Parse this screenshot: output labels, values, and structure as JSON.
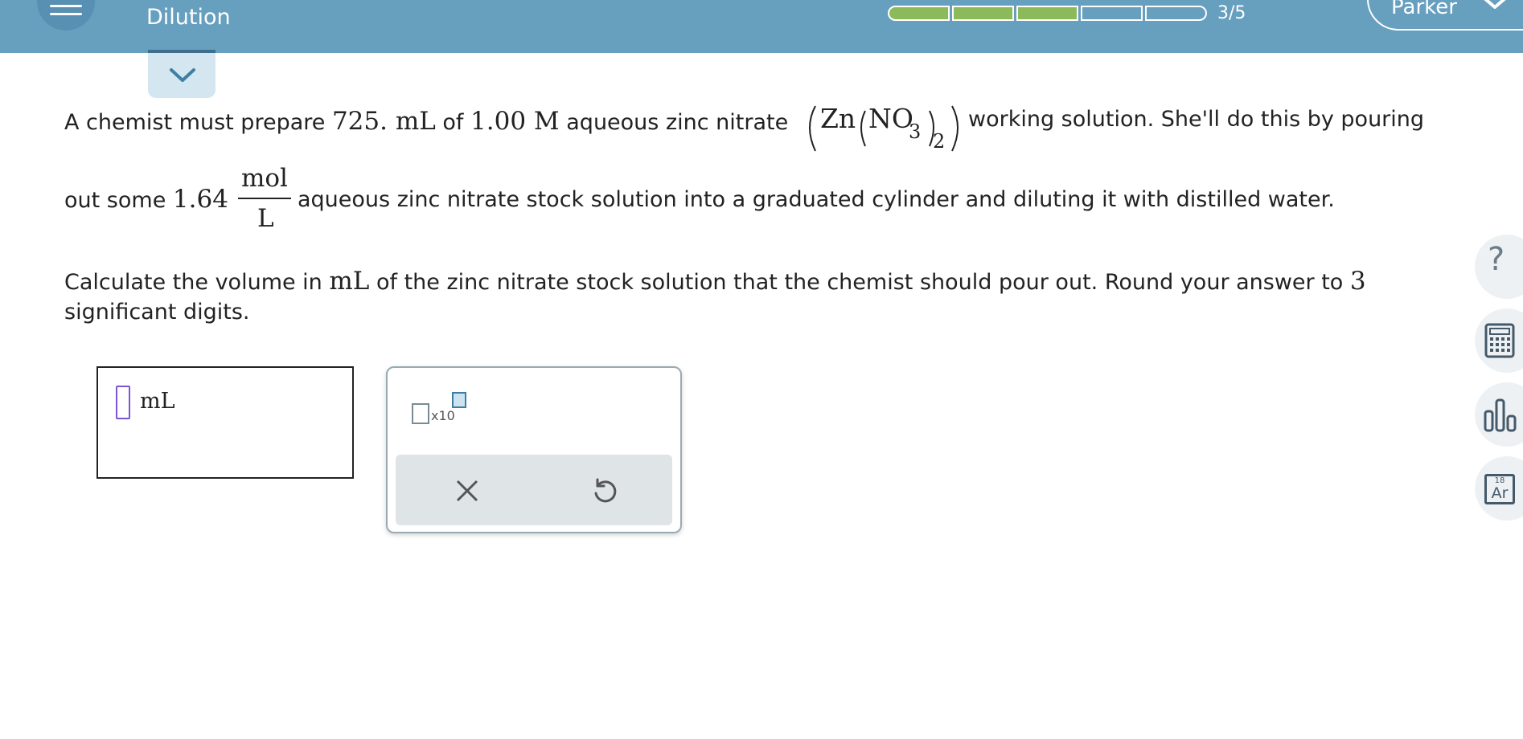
{
  "header": {
    "title": "Dilution",
    "progress": {
      "filled": 3,
      "total": 5,
      "label": "3/5"
    },
    "user_name": "Parker"
  },
  "question": {
    "line1": {
      "t1": "A chemist must prepare ",
      "volume": "725.",
      "unit1": " mL",
      "t2": " of ",
      "molarity": "1.00",
      "unit2": " M",
      "t3": " aqueous zinc nitrate ",
      "formula": {
        "zn": "Zn",
        "no": "NO",
        "sub3": "3",
        "sub2": "2"
      },
      "t4": " working solution. She'll do this by pouring"
    },
    "line2": {
      "t1": "out some ",
      "stock": "1.64",
      "frac_num": "mol",
      "frac_den": "L",
      "t2": " aqueous zinc nitrate stock solution into a graduated cylinder and diluting it with distilled water."
    },
    "line3": {
      "t1": "Calculate the volume in ",
      "unit": "mL",
      "t2": " of the zinc nitrate stock solution that the chemist should pour out. Round your answer to ",
      "digits": "3"
    },
    "line4": "significant digits."
  },
  "answer": {
    "value": "",
    "unit": "mL"
  },
  "palette": {
    "sci_label": "x10"
  },
  "sidebar": {
    "help": "?",
    "periodic_number": "18",
    "periodic_symbol": "Ar"
  }
}
